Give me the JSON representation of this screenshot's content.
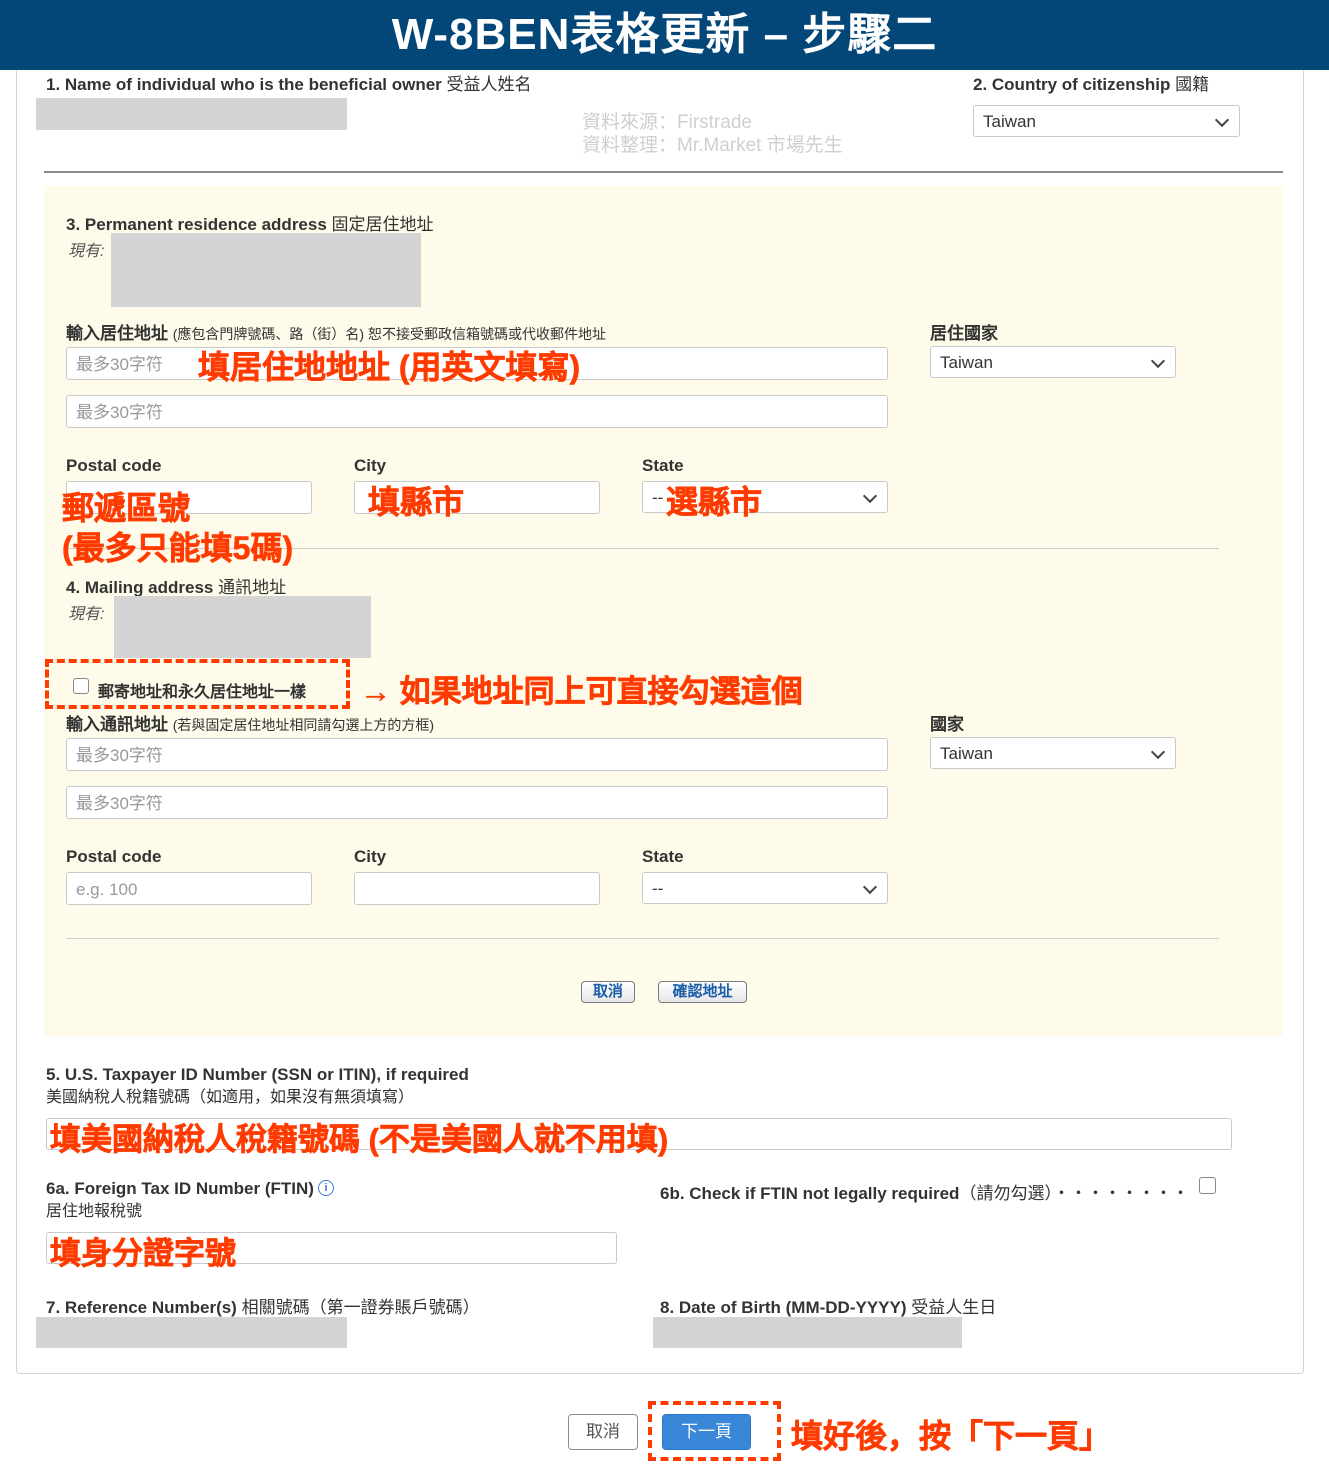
{
  "banner": {
    "title": "W-8BEN表格更新 – 步驟二"
  },
  "watermark": {
    "line1": "資料來源：Firstrade",
    "line2": "資料整理：Mr.Market 市場先生"
  },
  "s1": {
    "label_bold": "1. Name of individual who is the beneficial owner",
    "label_zh": "受益人姓名"
  },
  "s2": {
    "label_bold": "2. Country of citizenship",
    "label_zh": "國籍",
    "value": "Taiwan"
  },
  "s3": {
    "label_bold": "3. Permanent residence address",
    "label_zh": "固定居住地址",
    "current": "現有:",
    "input_label_bold": "輸入居住地址",
    "input_label_note": "(應包含門牌號碼、路（街）名) 恕不接受郵政信箱號碼或代收郵件地址",
    "address_placeholder": "最多30字符",
    "country_label": "居住國家",
    "country_value": "Taiwan",
    "postal_label": "Postal code",
    "city_label": "City",
    "state_label": "State",
    "state_value": "--"
  },
  "s4": {
    "label_bold": "4. Mailing address",
    "label_zh": "通訊地址",
    "current": "現有:",
    "same_checkbox": "郵寄地址和永久居住地址一樣",
    "input_label_bold": "輸入通訊地址",
    "input_label_note": "(若與固定居住地址相同請勾選上方的方框)",
    "address_placeholder": "最多30字符",
    "country_label": "國家",
    "country_value": "Taiwan",
    "postal_label": "Postal code",
    "postal_placeholder": "e.g. 100",
    "city_label": "City",
    "state_label": "State",
    "state_value": "--"
  },
  "address_buttons": {
    "cancel": "取消",
    "confirm": "確認地址"
  },
  "s5": {
    "label_bold": "5. U.S. Taxpayer ID Number (SSN or ITIN), if required",
    "label_zh": "美國納稅人稅籍號碼（如適用，如果沒有無須填寫）"
  },
  "s6a": {
    "label_bold": "6a. Foreign Tax ID Number (FTIN)",
    "label_zh": "居住地報稅號",
    "info_glyph": "i"
  },
  "s6b": {
    "label_bold": "6b. Check if FTIN not legally required",
    "label_note": "（請勿勾選）・・・・・・・・"
  },
  "s7": {
    "label_bold": "7. Reference Number(s)",
    "label_zh": "相關號碼（第一證券賬戶號碼）"
  },
  "s8": {
    "label_bold": "8. Date of Birth (MM-DD-YYYY)",
    "label_zh": "受益人生日"
  },
  "footer": {
    "cancel": "取消",
    "next": "下一頁"
  },
  "annotations": {
    "address": "填居住地地址 (用英文填寫)",
    "postal_1": "郵遞區號",
    "postal_2": "(最多只能填5碼)",
    "city": "填縣市",
    "state": "選縣市",
    "same_address": "→ 如果地址同上可直接勾選這個",
    "us_tax": "填美國納稅人稅籍號碼 (不是美國人就不用填)",
    "ftin": "填身分證字號",
    "next": "填好後，按「下一頁」"
  },
  "colors": {
    "banner": "#034778",
    "highlight": "#ff3b00",
    "address_bg": "#fefbea",
    "primary_button": "#3a86d8"
  }
}
